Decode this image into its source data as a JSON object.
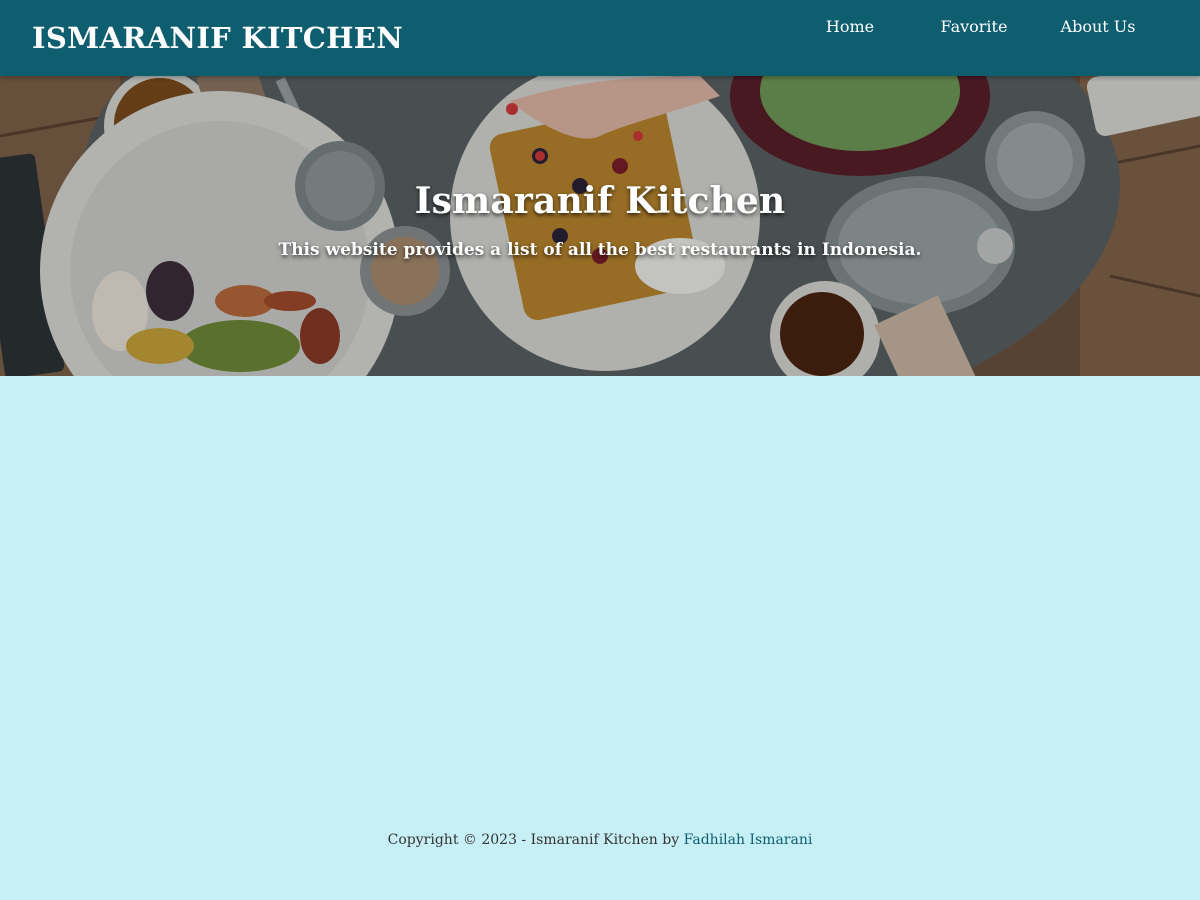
{
  "header": {
    "brand": "ISMARANIF KITCHEN",
    "nav": [
      {
        "label": "Home"
      },
      {
        "label": "Favorite"
      },
      {
        "label": "About Us"
      }
    ]
  },
  "hero": {
    "title": "Ismaranif Kitchen",
    "subtitle": "This website provides a list of all the best restaurants in Indonesia."
  },
  "footer": {
    "text": "Copyright © 2023 - Ismaranif Kitchen by",
    "author": "Fadhilah Ismarani"
  },
  "colors": {
    "header_bg": "#0f5e70",
    "page_bg": "#c6eff6",
    "footer_link": "#0f5e70"
  }
}
